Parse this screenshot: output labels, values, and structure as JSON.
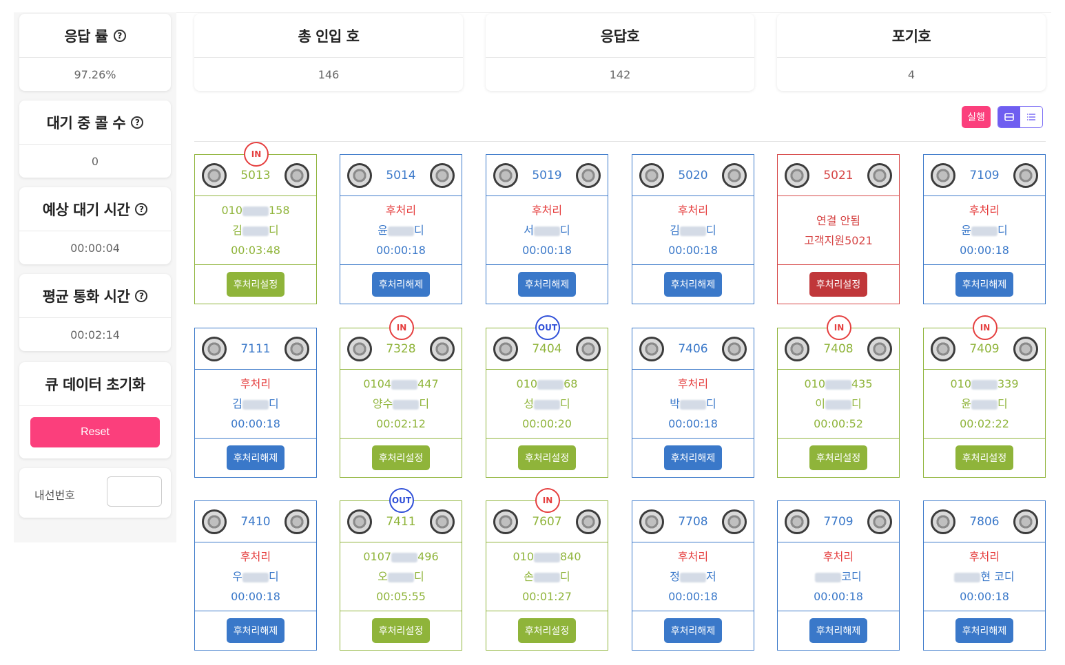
{
  "stats_left": [
    {
      "title": "응답 률",
      "value": "97.26%",
      "help": true
    },
    {
      "title": "대기 중 콜 수",
      "value": "0",
      "help": true
    },
    {
      "title": "예상 대기 시간",
      "value": "00:00:04",
      "help": true
    },
    {
      "title": "평균 통화 시간",
      "value": "00:02:14",
      "help": true
    }
  ],
  "stats_top": [
    {
      "title": "총 인입 호",
      "value": "146"
    },
    {
      "title": "응답호",
      "value": "142"
    },
    {
      "title": "포기호",
      "value": "4"
    }
  ],
  "help_icon": "question-circle-icon",
  "reset_card": {
    "title": "큐 데이터 초기화",
    "button": "Reset"
  },
  "extension_filter": {
    "label": "내선번호",
    "value": ""
  },
  "toolbar": {
    "run_label": "실행",
    "view_grid_icon": "grid-view-icon",
    "view_list_icon": "list-view-icon"
  },
  "agents": [
    {
      "ext": "5013",
      "state": "green",
      "badge": "IN",
      "l1a": "010",
      "l1b": "158",
      "l2a": "김",
      "l2b": "디",
      "time": "00:03:48",
      "btn": "후처리설정"
    },
    {
      "ext": "5014",
      "state": "blue",
      "badge": "",
      "status": "후처리",
      "l2a": "윤",
      "l2b": "디",
      "time": "00:00:18",
      "btn": "후처리해제"
    },
    {
      "ext": "5019",
      "state": "blue",
      "badge": "",
      "status": "후처리",
      "l2a": "서",
      "l2b": "디",
      "time": "00:00:18",
      "btn": "후처리해제"
    },
    {
      "ext": "5020",
      "state": "blue",
      "badge": "",
      "status": "후처리",
      "l2a": "김",
      "l2b": "디",
      "time": "00:00:18",
      "btn": "후처리해제"
    },
    {
      "ext": "5021",
      "state": "red",
      "badge": "",
      "status": "연결 안됨",
      "l2full": "고객지원5021",
      "btn": "후처리설정"
    },
    {
      "ext": "7109",
      "state": "blue",
      "badge": "",
      "status": "후처리",
      "l2a": "윤",
      "l2b": "디",
      "time": "00:00:18",
      "btn": "후처리해제"
    },
    {
      "ext": "7111",
      "state": "blue",
      "badge": "",
      "status": "후처리",
      "l2a": "김",
      "l2b": "디",
      "time": "00:00:18",
      "btn": "후처리해제"
    },
    {
      "ext": "7328",
      "state": "green",
      "badge": "IN",
      "l1a": "0104",
      "l1b": "447",
      "l2a": "양수",
      "l2b": "디",
      "time": "00:02:12",
      "btn": "후처리설정"
    },
    {
      "ext": "7404",
      "state": "green",
      "badge": "OUT",
      "l1a": "010",
      "l1b": "68",
      "l2a": "성",
      "l2b": "디",
      "time": "00:00:20",
      "btn": "후처리설정"
    },
    {
      "ext": "7406",
      "state": "blue",
      "badge": "",
      "status": "후처리",
      "l2a": "박",
      "l2b": "디",
      "time": "00:00:18",
      "btn": "후처리해제"
    },
    {
      "ext": "7408",
      "state": "green",
      "badge": "IN",
      "l1a": "010",
      "l1b": "435",
      "l2a": "이",
      "l2b": "디",
      "time": "00:00:52",
      "btn": "후처리설정"
    },
    {
      "ext": "7409",
      "state": "green",
      "badge": "IN",
      "l1a": "010",
      "l1b": "339",
      "l2a": "윤",
      "l2b": "디",
      "time": "00:02:22",
      "btn": "후처리설정"
    },
    {
      "ext": "7410",
      "state": "blue",
      "badge": "",
      "status": "후처리",
      "l2a": "우",
      "l2b": "디",
      "time": "00:00:18",
      "btn": "후처리해제"
    },
    {
      "ext": "7411",
      "state": "green",
      "badge": "OUT",
      "l1a": "0107",
      "l1b": "496",
      "l2a": "오",
      "l2b": "디",
      "time": "00:05:55",
      "btn": "후처리설정"
    },
    {
      "ext": "7607",
      "state": "green",
      "badge": "IN",
      "l1a": "010",
      "l1b": "840",
      "l2a": "손",
      "l2b": "디",
      "time": "00:01:27",
      "btn": "후처리설정"
    },
    {
      "ext": "7708",
      "state": "blue",
      "badge": "",
      "status": "후처리",
      "l2a": "정",
      "l2b": "저",
      "time": "00:00:18",
      "btn": "후처리해제"
    },
    {
      "ext": "7709",
      "state": "blue",
      "badge": "",
      "status": "후처리",
      "l2a": "",
      "l2b": "코디",
      "time": "00:00:18",
      "btn": "후처리해제"
    },
    {
      "ext": "7806",
      "state": "blue",
      "badge": "",
      "status": "후처리",
      "l2a": "",
      "l2b": "현 코디",
      "time": "00:00:18",
      "btn": "후처리해제"
    }
  ],
  "colors": {
    "green": "#8fb43a",
    "blue": "#3a78c9",
    "red": "#d64545",
    "accent": "#fb3f7c",
    "view": "#6f5ef0"
  }
}
